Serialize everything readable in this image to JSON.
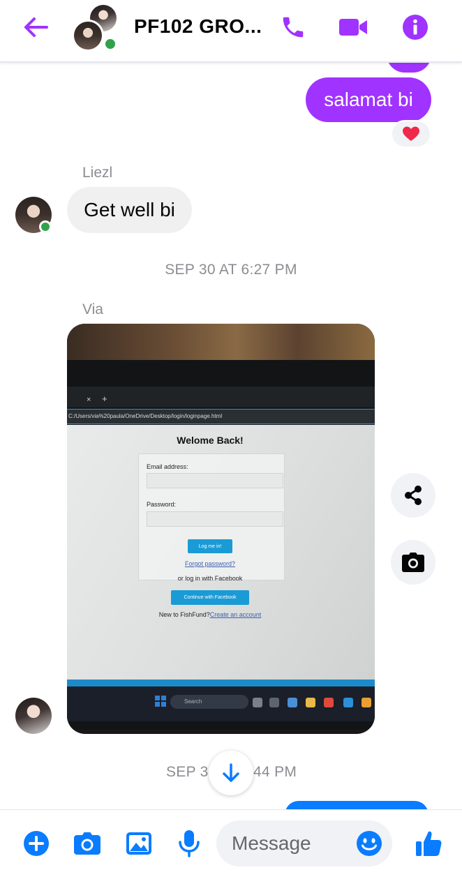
{
  "header": {
    "title": "PF102 GRO...",
    "icons": [
      "back-arrow-icon",
      "phone-icon",
      "video-camera-icon",
      "info-icon"
    ],
    "accent_color": "#a033ff"
  },
  "messages": {
    "outgoing": {
      "text": "salamat bi",
      "reaction": "❤️",
      "color": "#a033ff"
    },
    "liezl": {
      "sender": "Liezl",
      "text": "Get well bi"
    },
    "timestamp_1": "SEP 30 AT 6:27 PM",
    "via": {
      "sender": "Via"
    },
    "timestamp_2_left": "SEP 3",
    "timestamp_2_right": "44 PM"
  },
  "photo": {
    "url": "C:/Users/via%20paula/OneDrive/Desktop/login/loginpage.html",
    "page_title": "Welome Back!",
    "email_label": "Email address:",
    "password_label": "Password:",
    "login_button": "Log me in!",
    "forgot_link": "Forgot password?",
    "or_text": "or log in with Facebook",
    "facebook_button": "Continue with Facebook",
    "new_text": "New to FishFund?",
    "create_link": "Create an account",
    "search_text": "Search"
  },
  "side_actions": [
    "share-icon",
    "camera-icon"
  ],
  "composer": {
    "placeholder": "Message",
    "icons": [
      "plus-icon",
      "camera-icon",
      "gallery-icon",
      "microphone-icon",
      "emoji-icon",
      "thumbs-up-icon"
    ],
    "icon_color": "#0a7cff"
  }
}
